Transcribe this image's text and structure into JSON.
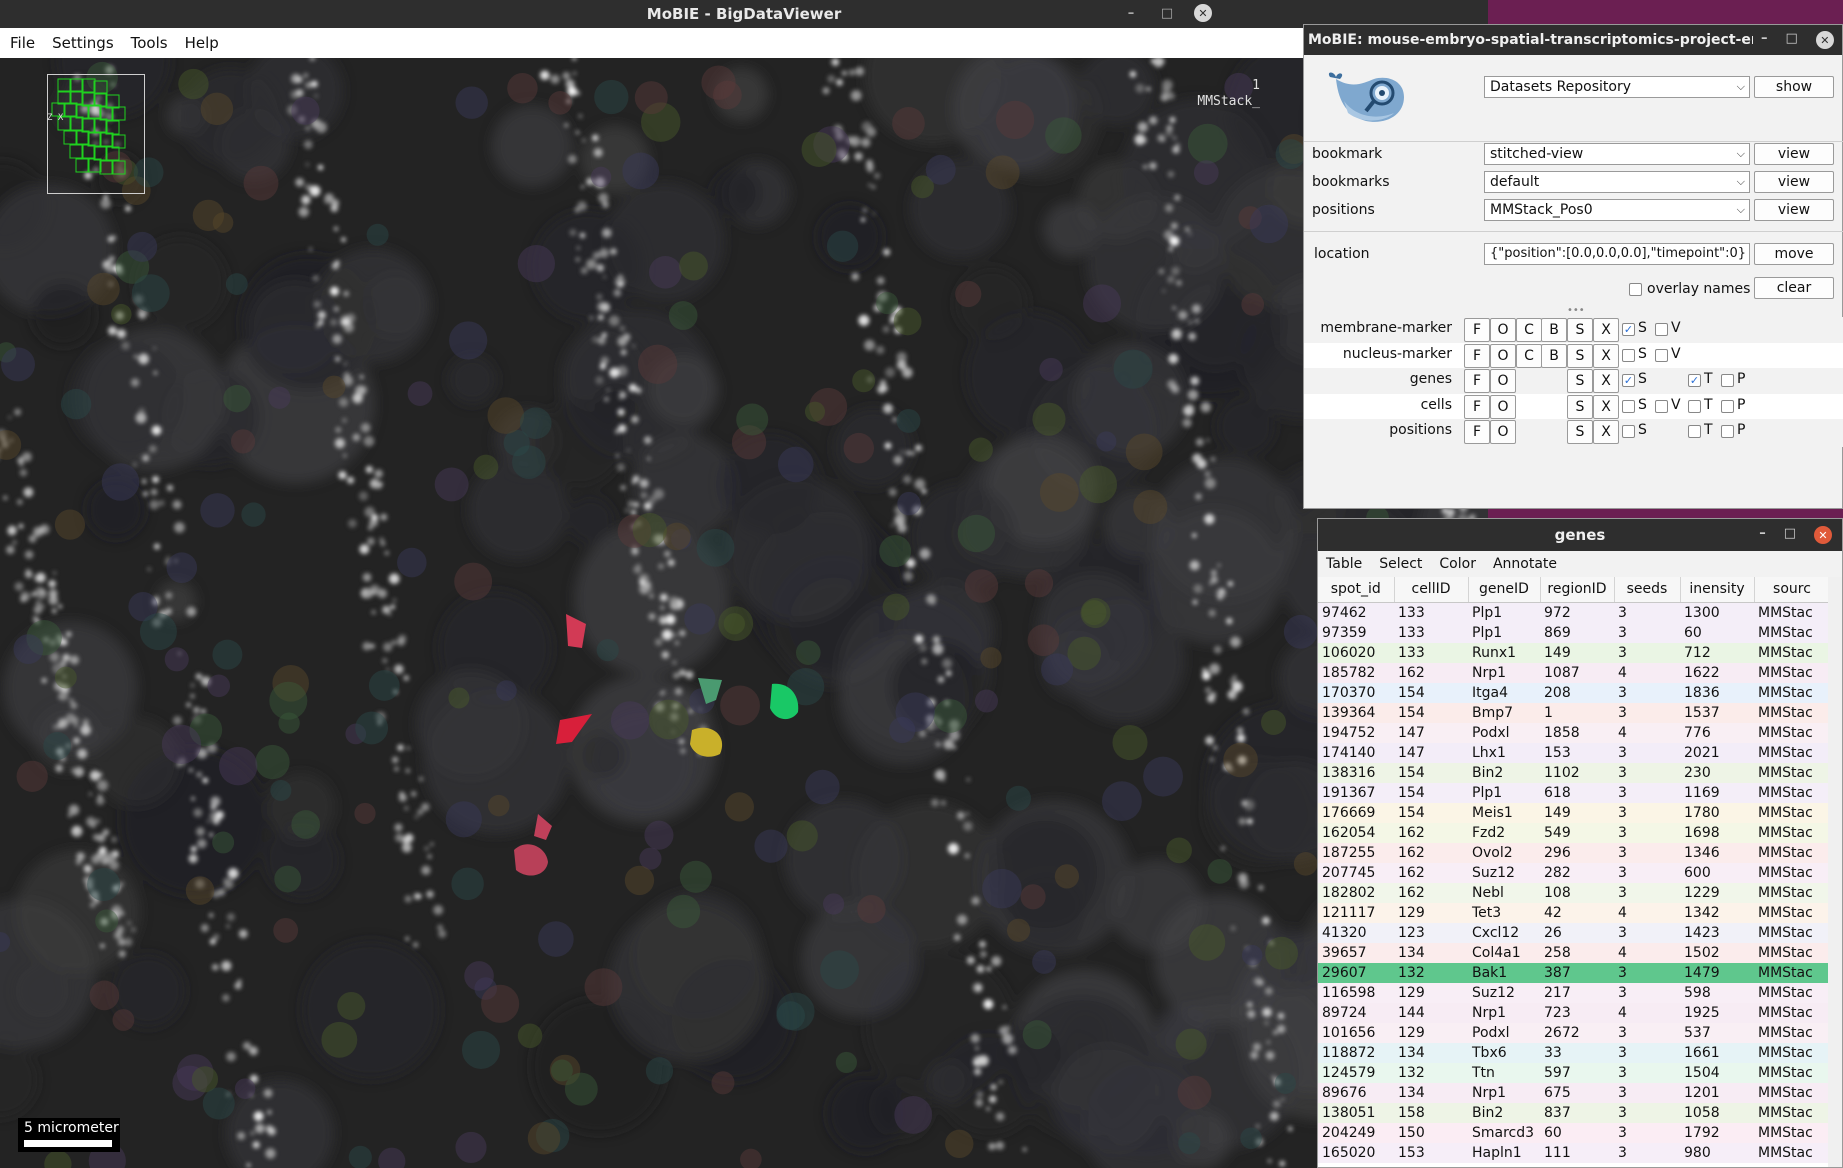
{
  "bdv": {
    "title": "MoBIE - BigDataViewer",
    "menu": [
      "File",
      "Settings",
      "Tools",
      "Help"
    ],
    "source_info_line1": "1",
    "source_info_line2": "MMStack_",
    "overview_label": "Z X",
    "scalebar_label": "5 micrometer"
  },
  "mobie": {
    "title": "MoBIE: mouse-embryo-spatial-transcriptomics-project-emb...",
    "repo_select": "Datasets Repository",
    "show_label": "show",
    "rows": [
      {
        "label": "bookmark",
        "value": "stitched-view",
        "action": "view"
      },
      {
        "label": "bookmarks",
        "value": "default",
        "action": "view"
      },
      {
        "label": "positions",
        "value": "MMStack_Pos0",
        "action": "view"
      }
    ],
    "location_label": "location",
    "location_value": "{\"position\":[0.0,0.0,0.0],\"timepoint\":0}",
    "move_label": "move",
    "overlay_names_label": "overlay names",
    "clear_label": "clear",
    "sources": [
      {
        "name": "membrane-marker",
        "buttons": [
          "F",
          "O",
          "C",
          "B",
          "S",
          "X"
        ],
        "checks": [
          {
            "label": "S",
            "checked": true
          },
          {
            "label": "V",
            "checked": false
          }
        ]
      },
      {
        "name": "nucleus-marker",
        "buttons": [
          "F",
          "O",
          "C",
          "B",
          "S",
          "X"
        ],
        "checks": [
          {
            "label": "S",
            "checked": false
          },
          {
            "label": "V",
            "checked": false
          }
        ]
      },
      {
        "name": "genes",
        "buttons": [
          "F",
          "O",
          "S",
          "X"
        ],
        "checks": [
          {
            "label": "S",
            "checked": true
          },
          {
            "label": "T",
            "checked": true
          },
          {
            "label": "P",
            "checked": false
          }
        ]
      },
      {
        "name": "cells",
        "buttons": [
          "F",
          "O",
          "S",
          "X"
        ],
        "checks": [
          {
            "label": "S",
            "checked": false
          },
          {
            "label": "V",
            "checked": false
          },
          {
            "label": "T",
            "checked": false
          },
          {
            "label": "P",
            "checked": false
          }
        ]
      },
      {
        "name": "positions",
        "buttons": [
          "F",
          "O",
          "S",
          "X"
        ],
        "checks": [
          {
            "label": "S",
            "checked": false
          },
          {
            "label": "T",
            "checked": false
          },
          {
            "label": "P",
            "checked": false
          }
        ]
      }
    ]
  },
  "genes": {
    "title": "genes",
    "menu": [
      "Table",
      "Select",
      "Color",
      "Annotate"
    ],
    "columns": [
      "spot_id",
      "cellID",
      "geneID",
      "regionID",
      "seeds",
      "inensity",
      "sourc"
    ],
    "rows": [
      [
        "97462",
        "133",
        "Plp1",
        "972",
        "3",
        "1300",
        "MMStac",
        "#f4eef8"
      ],
      [
        "97359",
        "133",
        "Plp1",
        "869",
        "3",
        "60",
        "MMStac",
        "#f4eef8"
      ],
      [
        "106020",
        "133",
        "Runx1",
        "149",
        "3",
        "712",
        "MMStac",
        "#eaf5e4"
      ],
      [
        "185782",
        "162",
        "Nrp1",
        "1087",
        "4",
        "1622",
        "MMStac",
        "#f7ecf4"
      ],
      [
        "170370",
        "154",
        "Itga4",
        "208",
        "3",
        "1836",
        "MMStac",
        "#e8f1fb"
      ],
      [
        "139364",
        "154",
        "Bmp7",
        "1",
        "3",
        "1537",
        "MMStac",
        "#fbecea"
      ],
      [
        "194752",
        "147",
        "Podxl",
        "1858",
        "4",
        "776",
        "MMStac",
        "#f9eff4"
      ],
      [
        "174140",
        "147",
        "Lhx1",
        "153",
        "3",
        "2021",
        "MMStac",
        "#f3edf8"
      ],
      [
        "138316",
        "154",
        "Bin2",
        "1102",
        "3",
        "230",
        "MMStac",
        "#eef4e6"
      ],
      [
        "191367",
        "154",
        "Plp1",
        "618",
        "3",
        "1169",
        "MMStac",
        "#f4eef8"
      ],
      [
        "176669",
        "154",
        "Meis1",
        "149",
        "3",
        "1780",
        "MMStac",
        "#fbf5e6"
      ],
      [
        "162054",
        "162",
        "Fzd2",
        "549",
        "3",
        "1698",
        "MMStac",
        "#f4f7e6"
      ],
      [
        "187255",
        "162",
        "Ovol2",
        "296",
        "3",
        "1346",
        "MMStac",
        "#fbecec"
      ],
      [
        "207745",
        "162",
        "Suz12",
        "282",
        "3",
        "600",
        "MMStac",
        "#f8eef6"
      ],
      [
        "182802",
        "162",
        "Nebl",
        "108",
        "3",
        "1229",
        "MMStac",
        "#f1f6ea"
      ],
      [
        "121117",
        "129",
        "Tet3",
        "42",
        "4",
        "1342",
        "MMStac",
        "#fcf3ea"
      ],
      [
        "41320",
        "123",
        "Cxcl12",
        "26",
        "3",
        "1423",
        "MMStac",
        "#f1f1f8"
      ],
      [
        "39657",
        "134",
        "Col4a1",
        "258",
        "4",
        "1502",
        "MMStac",
        "#fbecec"
      ],
      [
        "29607",
        "132",
        "Bak1",
        "387",
        "3",
        "1479",
        "MMStac",
        "#5fc78d"
      ],
      [
        "116598",
        "129",
        "Suz12",
        "217",
        "3",
        "598",
        "MMStac",
        "#f8eef6"
      ],
      [
        "89724",
        "144",
        "Nrp1",
        "723",
        "4",
        "1925",
        "MMStac",
        "#f7ecf4"
      ],
      [
        "101656",
        "129",
        "Podxl",
        "2672",
        "3",
        "537",
        "MMStac",
        "#f9eff4"
      ],
      [
        "118872",
        "134",
        "Tbx6",
        "33",
        "3",
        "1661",
        "MMStac",
        "#e6f3f6"
      ],
      [
        "124579",
        "132",
        "Ttn",
        "597",
        "3",
        "1504",
        "MMStac",
        "#e9f7ee"
      ],
      [
        "89676",
        "134",
        "Nrp1",
        "675",
        "3",
        "1201",
        "MMStac",
        "#f7ecf4"
      ],
      [
        "138051",
        "158",
        "Bin2",
        "837",
        "3",
        "1058",
        "MMStac",
        "#eef4e6"
      ],
      [
        "204249",
        "150",
        "Smarcd3",
        "60",
        "3",
        "1792",
        "MMStac",
        "#fbedf4"
      ],
      [
        "165020",
        "153",
        "Hapln1",
        "111",
        "3",
        "980",
        "MMStac",
        "#f6eef8"
      ]
    ],
    "selected_index": 18
  },
  "colors": {
    "desktop": "#6b1f52",
    "titlebar": "#2e2e2e",
    "selection": "#5fc78d",
    "checkbox_tick": "#2a6fd6"
  }
}
